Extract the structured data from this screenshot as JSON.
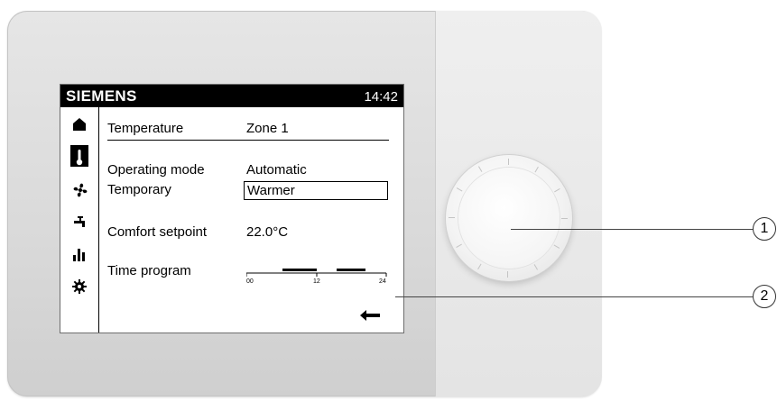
{
  "device": {
    "brand": "SIEMENS",
    "time": "14:42"
  },
  "menu": {
    "items": [
      {
        "icon": "home-icon",
        "active": false
      },
      {
        "icon": "thermometer-icon",
        "active": true
      },
      {
        "icon": "fan-icon",
        "active": false
      },
      {
        "icon": "faucet-icon",
        "active": false
      },
      {
        "icon": "bar-chart-icon",
        "active": false
      },
      {
        "icon": "gear-icon",
        "active": false
      }
    ]
  },
  "content": {
    "header_label": "Temperature",
    "header_value": "Zone 1",
    "operating_mode_label": "Operating mode",
    "operating_mode_value": "Automatic",
    "temporary_label": "Temporary",
    "temporary_value": "Warmer",
    "comfort_label": "Comfort setpoint",
    "comfort_value": "22.0°C",
    "time_program_label": "Time program",
    "time_program_ticks": [
      "00",
      "12",
      "24"
    ]
  },
  "callouts": [
    "1",
    "2"
  ]
}
